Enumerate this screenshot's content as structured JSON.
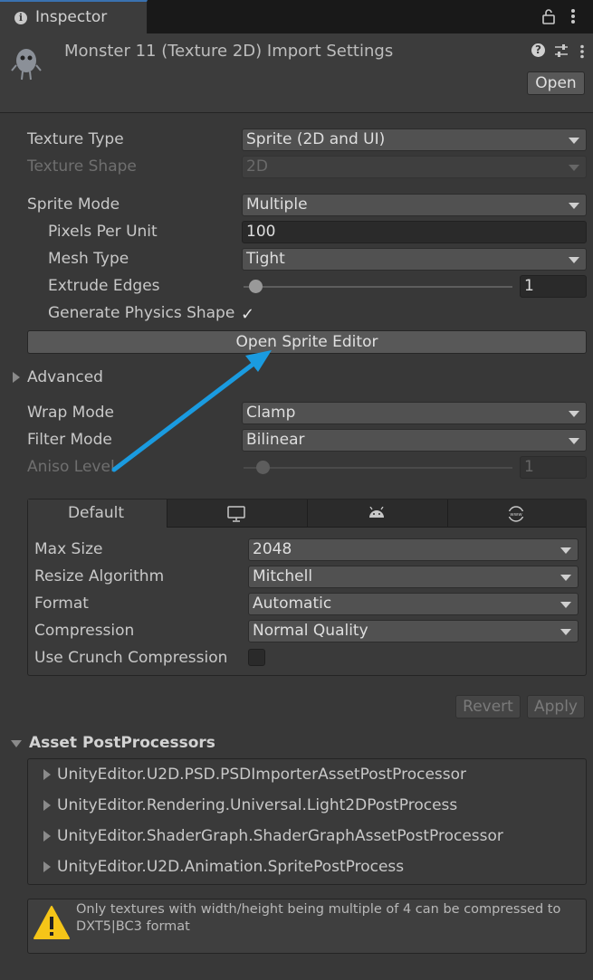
{
  "window": {
    "tab_title": "Inspector"
  },
  "header": {
    "title": "Monster 11 (Texture 2D) Import Settings",
    "open_label": "Open"
  },
  "texture": {
    "type_label": "Texture Type",
    "type_value": "Sprite (2D and UI)",
    "shape_label": "Texture Shape",
    "shape_value": "2D",
    "sprite_mode_label": "Sprite Mode",
    "sprite_mode_value": "Multiple",
    "ppu_label": "Pixels Per Unit",
    "ppu_value": "100",
    "mesh_type_label": "Mesh Type",
    "mesh_type_value": "Tight",
    "extrude_label": "Extrude Edges",
    "extrude_value": "1",
    "physics_label": "Generate Physics Shape",
    "physics_checked": true,
    "open_sprite_editor": "Open Sprite Editor",
    "advanced_label": "Advanced",
    "wrap_label": "Wrap Mode",
    "wrap_value": "Clamp",
    "filter_label": "Filter Mode",
    "filter_value": "Bilinear",
    "aniso_label": "Aniso Level",
    "aniso_value": "1"
  },
  "platform": {
    "tabs": [
      {
        "label": "Default",
        "icon": ""
      },
      {
        "label": "",
        "icon": "monitor-icon"
      },
      {
        "label": "",
        "icon": "android-icon"
      },
      {
        "label": "",
        "icon": "webgl-icon"
      }
    ],
    "max_size_label": "Max Size",
    "max_size_value": "2048",
    "resize_label": "Resize Algorithm",
    "resize_value": "Mitchell",
    "format_label": "Format",
    "format_value": "Automatic",
    "compression_label": "Compression",
    "compression_value": "Normal Quality",
    "crunch_label": "Use Crunch Compression",
    "crunch_checked": false
  },
  "actions": {
    "revert": "Revert",
    "apply": "Apply"
  },
  "postprocessors": {
    "title": "Asset PostProcessors",
    "items": [
      "UnityEditor.U2D.PSD.PSDImporterAssetPostProcessor",
      "UnityEditor.Rendering.Universal.Light2DPostProcess",
      "UnityEditor.ShaderGraph.ShaderGraphAssetPostProcessor",
      "UnityEditor.U2D.Animation.SpritePostProcess"
    ]
  },
  "help": {
    "warning": "Only textures with width/height being multiple of 4 can be compressed to DXT5|BC3 format"
  },
  "colors": {
    "annotation_arrow": "#1a9be0",
    "accent": "#3a72b0"
  }
}
